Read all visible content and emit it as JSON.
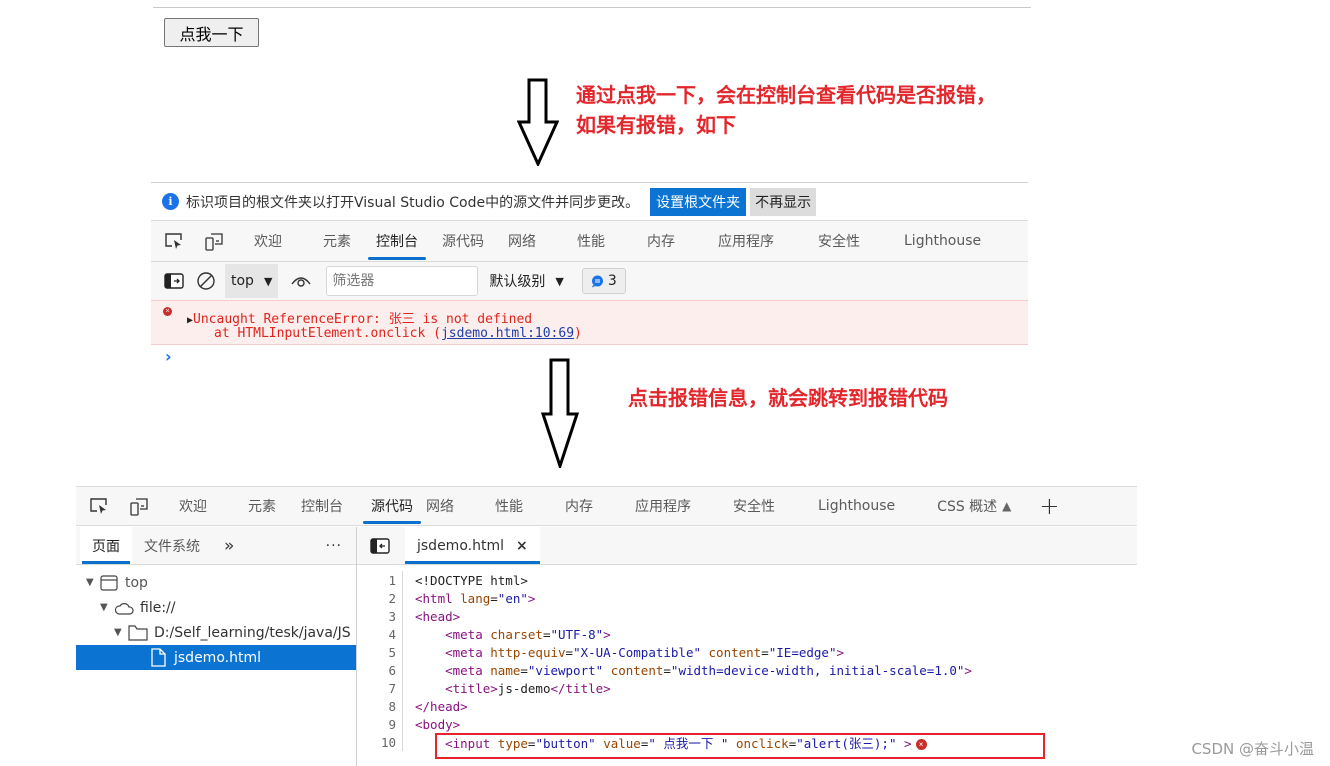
{
  "page": {
    "demo_button_label": "点我一下"
  },
  "annotations": {
    "step1": "通过点我一下，会在控制台查看代码是否报错，如果有报错，如下",
    "step2": "点击报错信息，就会跳转到报错代码"
  },
  "console_devtools": {
    "infobar": {
      "icon": "info-icon",
      "message": "标识项目的根文件夹以打开Visual Studio Code中的源文件并同步更改。",
      "primary_button": "设置根文件夹",
      "secondary_button": "不再显示"
    },
    "tabs": [
      {
        "label": "欢迎",
        "active": false
      },
      {
        "label": "元素",
        "active": false
      },
      {
        "label": "控制台",
        "active": true
      },
      {
        "label": "源代码",
        "active": false
      },
      {
        "label": "网络",
        "active": false
      },
      {
        "label": "性能",
        "active": false
      },
      {
        "label": "内存",
        "active": false
      },
      {
        "label": "应用程序",
        "active": false
      },
      {
        "label": "安全性",
        "active": false
      },
      {
        "label": "Lighthouse",
        "active": false
      }
    ],
    "toolbar": {
      "context": "top",
      "filter_placeholder": "筛选器",
      "level": "默认级别",
      "message_count": "3"
    },
    "error": {
      "line1": "Uncaught ReferenceError: 张三 is not defined",
      "line2_prefix": "at HTMLInputElement.onclick (",
      "link": "jsdemo.html:10:69",
      "line2_suffix": ")"
    },
    "prompt": "›"
  },
  "sources_devtools": {
    "tabs": [
      {
        "label": "欢迎",
        "active": false
      },
      {
        "label": "元素",
        "active": false
      },
      {
        "label": "控制台",
        "active": false
      },
      {
        "label": "源代码",
        "active": true
      },
      {
        "label": "网络",
        "active": false
      },
      {
        "label": "性能",
        "active": false
      },
      {
        "label": "内存",
        "active": false
      },
      {
        "label": "应用程序",
        "active": false
      },
      {
        "label": "安全性",
        "active": false
      },
      {
        "label": "Lighthouse",
        "active": false
      },
      {
        "label": "CSS 概述",
        "active": false
      }
    ],
    "add_tab": "+",
    "navigator": {
      "tabs": [
        {
          "label": "页面",
          "active": true
        },
        {
          "label": "文件系统",
          "active": false
        }
      ],
      "more": "»",
      "menu": "···",
      "tree": [
        {
          "label": "top",
          "icon": "frame-icon",
          "level": 0,
          "expanded": true
        },
        {
          "label": "file://",
          "icon": "cloud-icon",
          "level": 1,
          "expanded": true
        },
        {
          "label": "D:/Self_learning/tesk/java/JS",
          "icon": "folder-icon",
          "level": 2,
          "expanded": true
        },
        {
          "label": "jsdemo.html",
          "icon": "file-icon",
          "level": 3,
          "selected": true
        }
      ]
    },
    "editor": {
      "open_file": "jsdemo.html",
      "close": "×",
      "lines": [
        {
          "n": "1",
          "tokens": [
            [
              "t-plain",
              "<!DOCTYPE html>"
            ]
          ]
        },
        {
          "n": "2",
          "tokens": [
            [
              "t-tag",
              "<html "
            ],
            [
              "t-attr",
              "lang"
            ],
            [
              "t-plain",
              "="
            ],
            [
              "t-val",
              "\"en\""
            ],
            [
              "t-tag",
              ">"
            ]
          ]
        },
        {
          "n": "3",
          "tokens": [
            [
              "t-tag",
              "<head>"
            ]
          ]
        },
        {
          "n": "4",
          "tokens": [
            [
              "t-plain",
              "    "
            ],
            [
              "t-tag",
              "<meta "
            ],
            [
              "t-attr",
              "charset"
            ],
            [
              "t-plain",
              "="
            ],
            [
              "t-val",
              "\"UTF-8\""
            ],
            [
              "t-tag",
              ">"
            ]
          ]
        },
        {
          "n": "5",
          "tokens": [
            [
              "t-plain",
              "    "
            ],
            [
              "t-tag",
              "<meta "
            ],
            [
              "t-attr",
              "http-equiv"
            ],
            [
              "t-plain",
              "="
            ],
            [
              "t-val",
              "\"X-UA-Compatible\""
            ],
            [
              "t-plain",
              " "
            ],
            [
              "t-attr",
              "content"
            ],
            [
              "t-plain",
              "="
            ],
            [
              "t-val",
              "\"IE=edge\""
            ],
            [
              "t-tag",
              ">"
            ]
          ]
        },
        {
          "n": "6",
          "tokens": [
            [
              "t-plain",
              "    "
            ],
            [
              "t-tag",
              "<meta "
            ],
            [
              "t-attr",
              "name"
            ],
            [
              "t-plain",
              "="
            ],
            [
              "t-val",
              "\"viewport\""
            ],
            [
              "t-plain",
              " "
            ],
            [
              "t-attr",
              "content"
            ],
            [
              "t-plain",
              "="
            ],
            [
              "t-val",
              "\"width=device-width, initial-scale=1.0\""
            ],
            [
              "t-tag",
              ">"
            ]
          ]
        },
        {
          "n": "7",
          "tokens": [
            [
              "t-plain",
              "    "
            ],
            [
              "t-tag",
              "<title>"
            ],
            [
              "t-plain",
              "js-demo"
            ],
            [
              "t-tag",
              "</title>"
            ]
          ]
        },
        {
          "n": "8",
          "tokens": [
            [
              "t-tag",
              "</head>"
            ]
          ]
        },
        {
          "n": "9",
          "tokens": [
            [
              "t-tag",
              "<body>"
            ]
          ]
        },
        {
          "n": "10",
          "error": true,
          "tokens": [
            [
              "t-plain",
              "    "
            ],
            [
              "t-tag",
              "<input "
            ],
            [
              "t-attr",
              "type"
            ],
            [
              "t-plain",
              "="
            ],
            [
              "t-val",
              "\"button\""
            ],
            [
              "t-plain",
              " "
            ],
            [
              "t-attr",
              "value"
            ],
            [
              "t-plain",
              "="
            ],
            [
              "t-val",
              "\" 点我一下 \""
            ],
            [
              "t-plain",
              " "
            ],
            [
              "t-attr",
              "onclick"
            ],
            [
              "t-plain",
              "="
            ],
            [
              "t-val",
              "\"alert(张三);\""
            ],
            [
              "t-plain",
              " "
            ],
            [
              "t-tag",
              ">"
            ]
          ]
        }
      ]
    }
  },
  "watermark": "CSDN @奋斗小温"
}
